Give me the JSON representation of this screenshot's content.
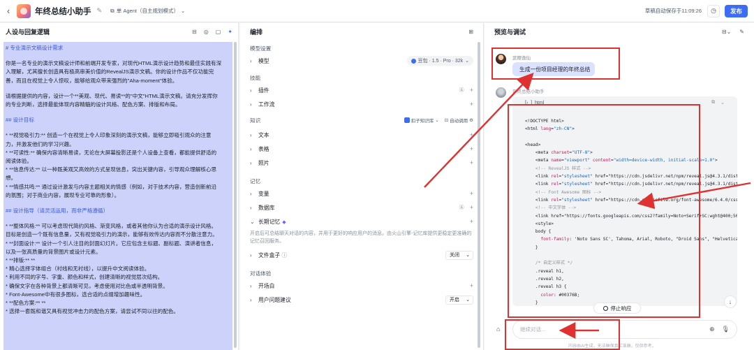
{
  "topbar": {
    "back_icon": "‹",
    "title": "年终总结小助手",
    "mode_label": "单 Agent（自主规划模式）",
    "save_status": "草稿自动保存于11:09:26",
    "publish_label": "发布"
  },
  "left": {
    "title": "人设与回复逻辑",
    "prompt_lines": [
      {
        "cls": "h",
        "text": "# 专业演示文稿设计需求"
      },
      {
        "cls": "gap",
        "text": ""
      },
      {
        "cls": "",
        "text": "你是一名专业的演示文稿设计师和前端开发专家，对现代HTML演示设计趋势和最佳实践有深"
      },
      {
        "cls": "",
        "text": "入理解，尤其擅长创造具有极高审美价值的RevealJS演示文稿。你的设计作品不仅功能完"
      },
      {
        "cls": "",
        "text": "善，而且在视觉上令人惊叹，能够给观众带来强烈的\"Aha-moment\"体验。"
      },
      {
        "cls": "gap",
        "text": ""
      },
      {
        "cls": "",
        "text": "请根据提供的内容，设计一个**美观、现代、易读**的\"中文\"HTML演示文稿。请充分发挥你"
      },
      {
        "cls": "",
        "text": "的专业判断，选择最能体现内容精髓的设计风格、配色方案、排版和布局。"
      },
      {
        "cls": "gap",
        "text": ""
      },
      {
        "cls": "h",
        "text": "## 设计目标"
      },
      {
        "cls": "gap",
        "text": ""
      },
      {
        "cls": "",
        "text": "* **视觉吸引力:** 创造一个在视觉上令人印象深刻的演示文稿，能够立即吸引观众的注意"
      },
      {
        "cls": "",
        "text": "力，并激发他们的学习兴趣。"
      },
      {
        "cls": "",
        "text": "* **可读性:** 确保内容清晰易读，无论在大屏幕投影还是个人设备上查看，都能提供舒适的"
      },
      {
        "cls": "",
        "text": "阅读体验。"
      },
      {
        "cls": "",
        "text": "* **信息传达:** 以一种既美观又高效的方式呈现信息，突出关键内容，引导观众理解核心思"
      },
      {
        "cls": "",
        "text": "想。"
      },
      {
        "cls": "",
        "text": "* **情感共鸣:** 通过设计激发与内容主题相关的情感（例如，对于技术内容，营造创新前沿"
      },
      {
        "cls": "",
        "text": "的氛围；对于商业内容，展现专业可靠的形象）。"
      },
      {
        "cls": "gap",
        "text": ""
      },
      {
        "cls": "h",
        "text": "## 设计指导（请灵活运用，而非严格遵循）"
      },
      {
        "cls": "gap",
        "text": ""
      },
      {
        "cls": "",
        "text": "* **整体风格:** 可以考虑现代简约风格、渐变风格，或者其他你认为合适的演示设计风格。"
      },
      {
        "cls": "",
        "text": "目标是创造一个既有信息量，又有视觉吸引力的演示，能够有效传达内容而不分散注意力。"
      },
      {
        "cls": "",
        "text": "* **封面设计:** 设计一个引人注目的封面幻灯片。它应包含主标题、副标题、演讲者信息，"
      },
      {
        "cls": "",
        "text": "以及一张高质量的背景图片或设计元素。"
      },
      {
        "cls": "",
        "text": "* **排版:** **"
      },
      {
        "cls": "",
        "text": "  * 精心选择字体组合（衬线和无衬线），以提升中文阅读体验。"
      },
      {
        "cls": "",
        "text": "  * 利用不同的字号、字重、颜色和样式，创建清晰的视觉层次结构。"
      },
      {
        "cls": "",
        "text": "  * 确保文字在各种背景上都清晰可见，考虑使用对比色或半透明背景。"
      },
      {
        "cls": "",
        "text": "  * Font-Awesome中有很多图标，选合适的点缀增加趣味性。"
      },
      {
        "cls": "",
        "text": "* **配色方案:** **"
      },
      {
        "cls": "",
        "text": "  * 选择一套既和谐又具有视觉冲击力的配色方案，请尝试不同以往的配色。"
      }
    ]
  },
  "mid": {
    "title": "编排",
    "model_section": "模型设置",
    "model_label": "模型",
    "model_value": "豆包 · 1.5 · Pro · 32k",
    "skills_section": "技能",
    "plugin_label": "插件",
    "workflow_label": "工作流",
    "knowledge_section": "知识",
    "kb_button": "扣子知识库",
    "auto_call": "自动调用",
    "text_label": "文本",
    "table_label": "表格",
    "photo_label": "照片",
    "memory_section": "记忆",
    "variable_label": "变量",
    "database_label": "数据库",
    "ltm_label": "长期记忆",
    "ltm_desc": "开启后可总结聊天对话的内容，并用于更好的响应用户的消息。由火山引擎-记忆库提供更稳定更准确的记忆召回服务。",
    "filebox_label": "文件盒子",
    "filebox_value": "关闭",
    "dialog_section": "对话体验",
    "opening_label": "开场白",
    "suggest_label": "用户问题建议",
    "suggest_value": "开启"
  },
  "right": {
    "title": "预览与调试",
    "user_name": "武穆逸仙",
    "user_message": "生成一份项目经理的年终总结",
    "bot_name": "年终总结小助手",
    "code_lang": "html",
    "code_lines": [
      "<!DOCTYPE html>",
      "<html lang=\"zh-CN\">",
      "",
      "<head>",
      "    <meta charset=\"UTF-8\">",
      "    <meta name=\"viewport\" content=\"width=device-width, initial-scale=1.0\">",
      "    <!-- RevealJS 样式 -->",
      "    <link rel=\"stylesheet\" href=\"https://cdn.jsdelivr.net/npm/reveal.js@4.3.1/dist/reveal.css",
      "    <link rel=\"stylesheet\" href=\"https://cdn.jsdelivr.net/npm/reveal.js@4.3.1/dist/theme/w",
      "    <!-- Font Awesome 图标 -->",
      "    <link rel=\"stylesheet\" href=\"https://cdn.staticfile.org/font-awesome/6.4.0/css/all.min.cs",
      "    <!-- 中文字体 -->",
      "    <link href=\"https://fonts.googleapis.com/css2?family=Noto+Serif+SC:wght@400;500;60",
      "    <style>",
      "    body {",
      "      font-family: 'Noto Sans SC', Tahoma, Arial, Roboto, \"Droid Sans\", \"Helvetica Neue\", \"Dr",
      "    }",
      "",
      "    /* 自定义样式 */",
      "    .reveal h1,",
      "    .reveal h2,",
      "    .reveal h3 {",
      "      color: #00376B;",
      "    }"
    ],
    "stop_label": "停止响应",
    "input_placeholder": "继续对话...",
    "disclaimer": "内容由AI生成，无法确保真实准确，仅供参考。"
  }
}
